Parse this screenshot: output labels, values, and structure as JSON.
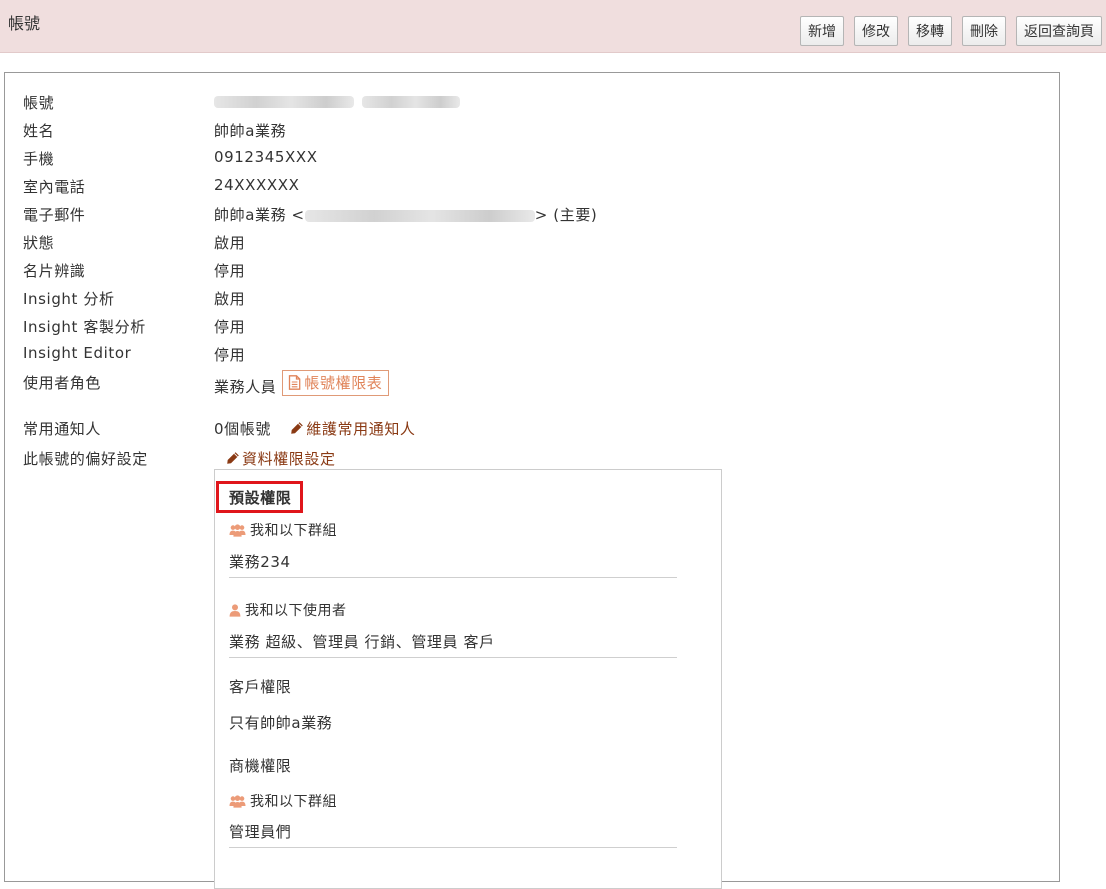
{
  "header": {
    "title": "帳號",
    "buttons": [
      "新增",
      "修改",
      "移轉",
      "刪除",
      "返回查詢頁"
    ]
  },
  "account": {
    "fields": [
      {
        "label": "帳號",
        "value": ""
      },
      {
        "label": "姓名",
        "value": "帥帥a業務"
      },
      {
        "label": "手機",
        "value": "0912345XXX"
      },
      {
        "label": "室內電話",
        "value": "24XXXXXX"
      },
      {
        "label": "電子郵件",
        "value_prefix": "帥帥a業務 <",
        "value_suffix": "> (主要)"
      },
      {
        "label": "狀態",
        "value": "啟用"
      },
      {
        "label": "名片辨識",
        "value": "停用"
      },
      {
        "label": "Insight 分析",
        "value": "啟用"
      },
      {
        "label": "Insight 客製分析",
        "value": "停用"
      },
      {
        "label": "Insight Editor",
        "value": "停用"
      },
      {
        "label": "使用者角色",
        "value": "業務人員",
        "link": "帳號權限表"
      },
      {
        "label": "常用通知人",
        "value": "0個帳號",
        "link": "維護常用通知人"
      },
      {
        "label": "此帳號的偏好設定",
        "link": "資料權限設定"
      }
    ]
  },
  "preferences": {
    "default_title": "預設權限",
    "group_label": "我和以下群組",
    "group_value": "業務234",
    "user_label": "我和以下使用者",
    "user_value": "業務 超級、管理員 行銷、管理員 客戶",
    "customer_title": "客戶權限",
    "customer_value": "只有帥帥a業務",
    "opportunity_title": "商機權限",
    "opp_group_label": "我和以下群組",
    "opp_group_value": "管理員們"
  },
  "colors": {
    "header_bg": "#f0dede",
    "link": "#8a3a14",
    "icon_orange": "#ec9b78",
    "highlight": "#e0161b"
  }
}
